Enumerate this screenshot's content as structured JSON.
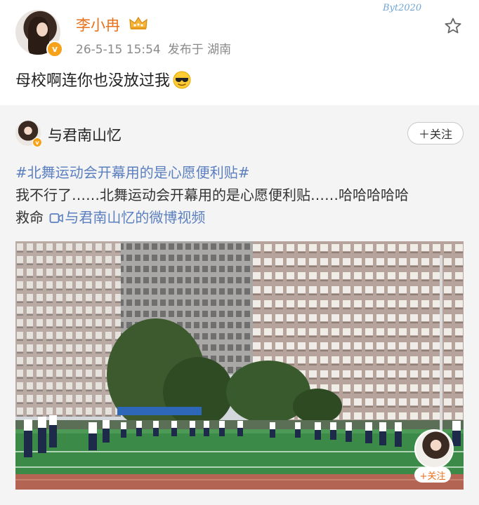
{
  "post": {
    "author": "李小冉",
    "timestamp": "26-5-15 15:54",
    "location_prefix": "发布于",
    "location": "湖南",
    "text": "母校啊连你也没放过我",
    "verified_mark": "v",
    "watermark": "Byt2020"
  },
  "icons": {
    "crown": "crown-icon",
    "star": "star-icon",
    "sunglasses": "sunglasses-emoji-icon",
    "video": "video-link-icon"
  },
  "repost": {
    "author": "与君南山忆",
    "verified_mark": "v",
    "follow_label": "＋关注",
    "topic": "#北舞运动会开幕用的是心愿便利贴#",
    "body_line1": "我不行了……北舞运动会开幕用的是心愿便利贴……哈哈哈哈哈",
    "body_line2_prefix": "救命",
    "video_link": "与君南山忆的微博视频"
  },
  "video": {
    "follow_label": "+关注"
  },
  "colors": {
    "author_orange": "#e8721c",
    "link_blue": "#5b7fbf",
    "repost_bg": "#f4f4f4",
    "badge_gold": "#f7a21b"
  }
}
